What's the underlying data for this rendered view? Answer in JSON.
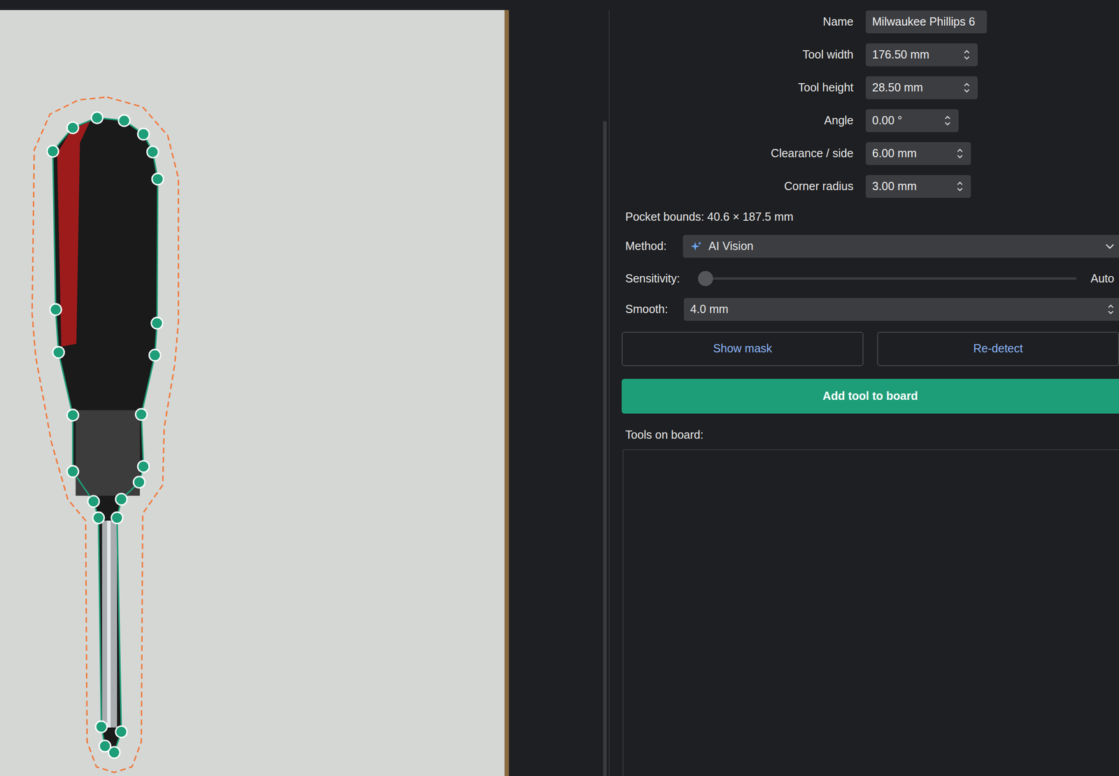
{
  "editor": {
    "fields": [
      {
        "label": "Name",
        "value": "Milwaukee Phillips 6",
        "kind": "text"
      },
      {
        "label": "Tool width",
        "value": "176.50 mm",
        "kind": "spinner"
      },
      {
        "label": "Tool height",
        "value": "28.50 mm",
        "kind": "spinner"
      },
      {
        "label": "Angle",
        "value": "0.00 °",
        "kind": "spinner"
      },
      {
        "label": "Clearance / side",
        "value": "6.00 mm",
        "kind": "spinner"
      },
      {
        "label": "Corner radius",
        "value": "3.00 mm",
        "kind": "spinner"
      }
    ],
    "pocket_bounds": "Pocket bounds: 40.6 × 187.5 mm",
    "method": {
      "label": "Method:",
      "value": "AI Vision"
    },
    "sensitivity": {
      "label": "Sensitivity:",
      "level": 0,
      "reading": "Auto"
    },
    "smooth": {
      "label": "Smooth:",
      "value": "4.0 mm"
    },
    "buttons": [
      {
        "label": "Show mask"
      },
      {
        "label": "Re-detect"
      }
    ],
    "primary_button": {
      "label": "Add tool to board"
    },
    "tools_on_board": {
      "label": "Tools on board:",
      "items": []
    }
  }
}
